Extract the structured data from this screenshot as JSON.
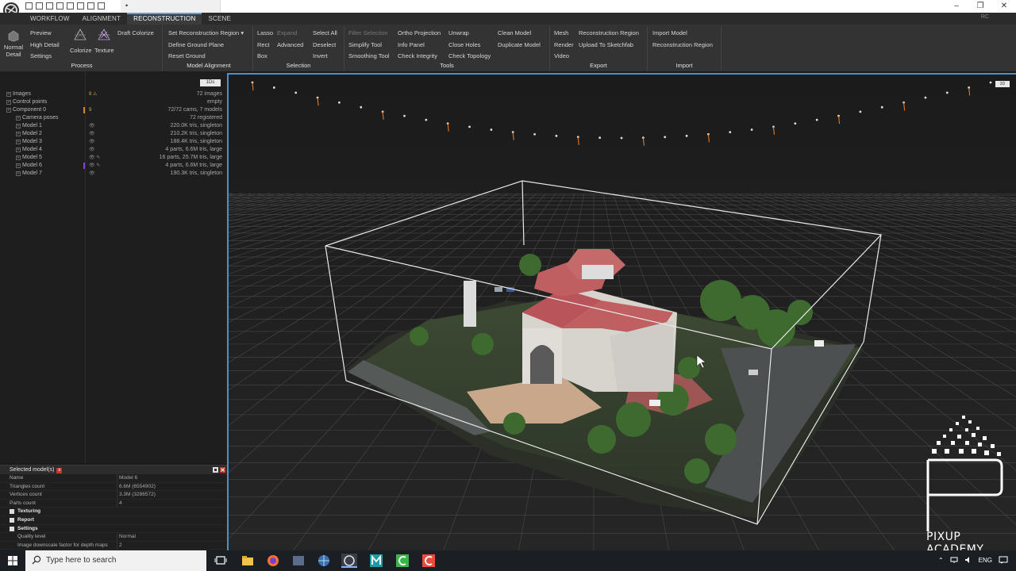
{
  "titlebar": {
    "doc_tab": "•",
    "minimize": "–",
    "restore": "❐",
    "close": "✕"
  },
  "ribbon": {
    "tabs": [
      "WORKFLOW",
      "ALIGNMENT",
      "RECONSTRUCTION",
      "SCENE"
    ],
    "active_tab": "RECONSTRUCTION",
    "rc_tag": "RC",
    "normal_detail": "Normal Detail",
    "process": {
      "preview": "Preview",
      "high_detail": "High Detail",
      "settings": "Settings",
      "colorize": "Colorize",
      "texture": "Texture",
      "draft_colorize": "Draft Colorize",
      "label": "Process"
    },
    "model_alignment": {
      "set_region": "Set Reconstruction Region",
      "ground_plane": "Define Ground Plane",
      "reset_ground": "Reset Ground",
      "label": "Model Alignment"
    },
    "selection": {
      "lasso": "Lasso",
      "expand": "Expand",
      "rect": "Rect",
      "advanced": "Advanced",
      "box": "Box",
      "select_all": "Select All",
      "deselect": "Deselect",
      "invert": "Invert",
      "label": "Selection"
    },
    "tools": {
      "filter_selection": "Filter Selection",
      "simplify": "Simplify Tool",
      "smoothing": "Smoothing Tool",
      "ortho": "Ortho Projection",
      "info_panel": "Info Panel",
      "check_integrity": "Check Integrity",
      "unwrap": "Unwrap",
      "close_holes": "Close Holes",
      "check_topology": "Check Topology",
      "clean_model": "Clean Model",
      "duplicate_model": "Duplicate Model",
      "label": "Tools"
    },
    "export": {
      "mesh": "Mesh",
      "render": "Render",
      "video": "Video",
      "recon_region": "Reconstruction Region",
      "sketchfab": "Upload To Sketchfab",
      "label": "Export"
    },
    "import": {
      "import_model": "Import Model",
      "recon_region": "Reconstruction Region",
      "label": "Import"
    }
  },
  "left_panel": {
    "toolbar_badge": "1Ds",
    "tree": [
      {
        "name": "Images",
        "value": "72 images",
        "level": 0,
        "flag": "9",
        "warn": "⚠"
      },
      {
        "name": "Control points",
        "value": "empty",
        "level": 0
      },
      {
        "name": "Component 0",
        "value": "72/72 cams, 7 models",
        "level": 0,
        "flag": "9"
      },
      {
        "name": "Camera poses",
        "value": "72 registered",
        "level": 1
      },
      {
        "name": "Model 1",
        "value": "220.0K tris, singleton",
        "level": 1,
        "eye": "👁"
      },
      {
        "name": "Model 2",
        "value": "210.2K tris, singleton",
        "level": 1,
        "eye": "👁"
      },
      {
        "name": "Model 3",
        "value": "188.4K tris, singleton",
        "level": 1,
        "eye": "👁"
      },
      {
        "name": "Model 4",
        "value": "4 parts, 6.6M tris, large",
        "level": 1,
        "eye": "👁"
      },
      {
        "name": "Model 5",
        "value": "16 parts, 25.7M tris, large",
        "level": 1,
        "eye": "👁 ✎"
      },
      {
        "name": "Model 6",
        "value": "4 parts, 6.6M tris, large",
        "level": 1,
        "eye": "👁 ✎"
      },
      {
        "name": "Model 7",
        "value": "190.3K tris, singleton",
        "level": 1,
        "eye": "👁"
      }
    ]
  },
  "properties": {
    "header": "Selected model(s)",
    "header_close": "x",
    "rows": [
      {
        "k": "Name",
        "v": "Model 6",
        "type": "row"
      },
      {
        "k": "Triangles count",
        "v": "6.6M (6554902)",
        "type": "row"
      },
      {
        "k": "Vertices count",
        "v": "3.3M (3286572)",
        "type": "row"
      },
      {
        "k": "Parts count",
        "v": "4",
        "type": "row"
      },
      {
        "k": "Texturing",
        "v": "",
        "type": "sec"
      },
      {
        "k": "Report",
        "v": "",
        "type": "sec"
      },
      {
        "k": "Settings",
        "v": "",
        "type": "sec"
      },
      {
        "k": "Quality level",
        "v": "Normal",
        "type": "sub"
      },
      {
        "k": "Image downscale factor for depth maps",
        "v": "2",
        "type": "sub"
      }
    ]
  },
  "viewport": {
    "badge": "3D"
  },
  "watermark": {
    "text": "PIXUP ACADEMY"
  },
  "taskbar": {
    "search_placeholder": "Type here to search",
    "language": "ENG",
    "tray_up": "⌃"
  },
  "colors": {
    "accent": "#4a8fd8",
    "ribbon": "#333333",
    "roof": "#b9555a"
  }
}
